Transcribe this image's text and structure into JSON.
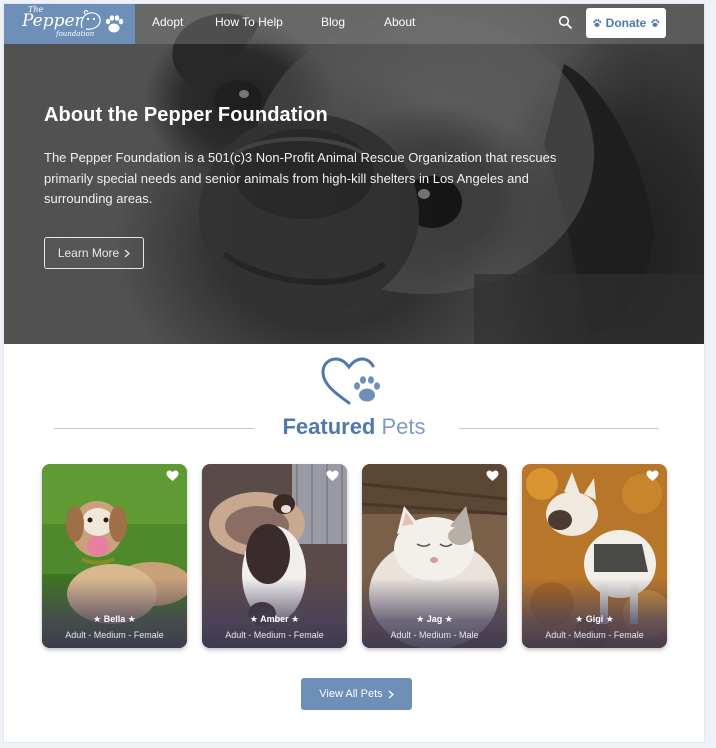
{
  "nav": {
    "logo": {
      "the": "The",
      "pepper": "Pepper",
      "foundation": "foundation"
    },
    "links": [
      "Adopt",
      "How To Help",
      "Blog",
      "About"
    ],
    "donate_label": "Donate",
    "accent_color": "#6d8fb8"
  },
  "hero": {
    "title": "About the Pepper Foundation",
    "description": "The Pepper Foundation is a 501(c)3 Non-Profit Animal Rescue Organization that rescues primarily special needs and senior animals from high-kill shelters in Los Angeles and surrounding areas.",
    "button_label": "Learn More"
  },
  "featured": {
    "title_bold": "Featured",
    "title_light": "Pets",
    "pets": [
      {
        "name": "★ Bella ★",
        "meta": "Adult - Medium - Female"
      },
      {
        "name": "★ Amber ★",
        "meta": "Adult - Medium - Female"
      },
      {
        "name": "★ Jag ★",
        "meta": "Adult - Medium - Male"
      },
      {
        "name": "★ Gigi ★",
        "meta": "Adult - Medium - Female"
      }
    ],
    "view_all_label": "View All Pets"
  },
  "icons": {
    "search": "search-icon",
    "paw": "paw-icon",
    "heart": "heart-icon",
    "chevron": "chevron-right-icon"
  },
  "colors": {
    "brand_blue": "#4f79ad",
    "button_blue": "#6d8fb8"
  }
}
